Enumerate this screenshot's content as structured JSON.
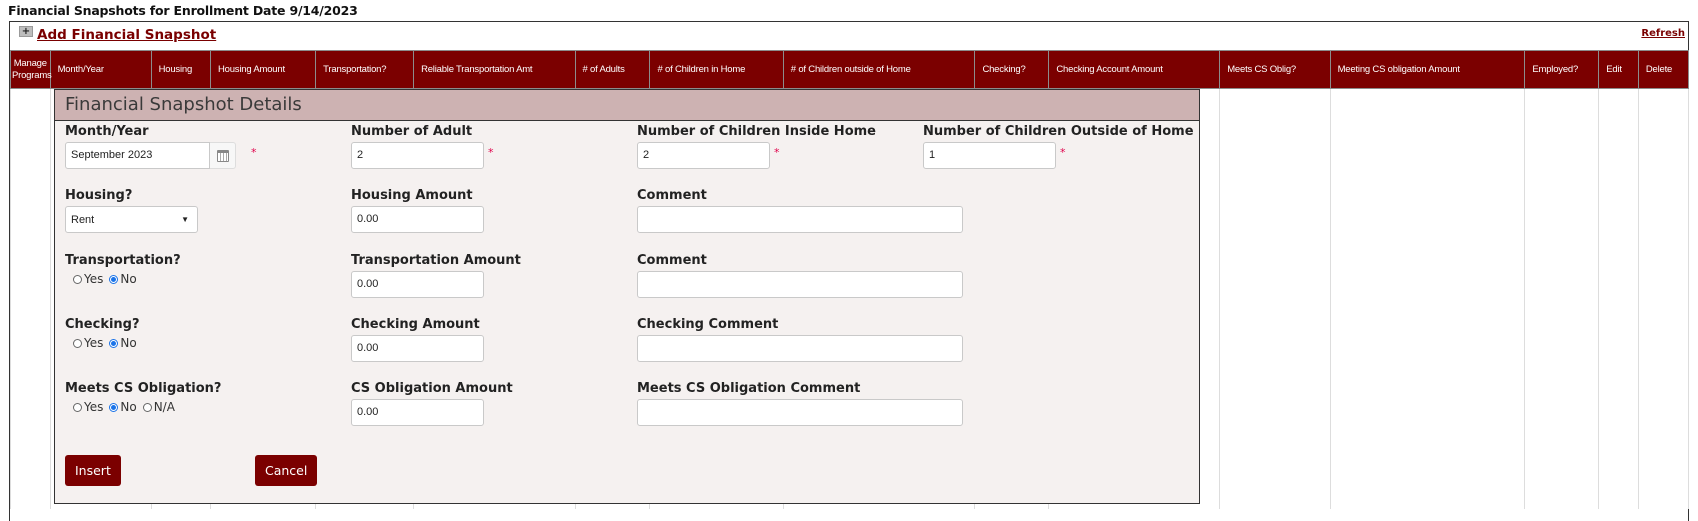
{
  "page": {
    "title": "Financial Snapshots for Enrollment Date 9/14/2023",
    "add_link": "Add Financial Snapshot",
    "refresh": "Refresh"
  },
  "grid": {
    "columns": [
      "Manage Programs",
      "Month/Year",
      "Housing",
      "Housing Amount",
      "Transportation?",
      "Reliable Transportation Amt",
      "# of Adults",
      "# of Children in Home",
      "# of Children outside of Home",
      "Checking?",
      "Checking Account Amount",
      "Meets CS Oblig?",
      "Meeting CS obligation Amount",
      "Employed?",
      "Edit",
      "Delete"
    ]
  },
  "panel": {
    "title": "Financial Snapshot Details",
    "month_year": {
      "label": "Month/Year",
      "value": "September 2023"
    },
    "num_adult": {
      "label": "Number of Adult",
      "value": "2"
    },
    "children_inside": {
      "label": "Number of Children Inside Home",
      "value": "2"
    },
    "children_outside": {
      "label": "Number of Children Outside of Home",
      "value": "1"
    },
    "housing": {
      "label": "Housing?",
      "value": "Rent"
    },
    "housing_amount": {
      "label": "Housing Amount",
      "value": "0.00"
    },
    "housing_comment": {
      "label": "Comment",
      "value": ""
    },
    "transportation": {
      "label": "Transportation?",
      "options": [
        "Yes",
        "No"
      ],
      "selected": "No"
    },
    "transportation_amount": {
      "label": "Transportation Amount",
      "value": "0.00"
    },
    "transportation_comment": {
      "label": "Comment",
      "value": ""
    },
    "checking": {
      "label": "Checking?",
      "options": [
        "Yes",
        "No"
      ],
      "selected": "No"
    },
    "checking_amount": {
      "label": "Checking Amount",
      "value": "0.00"
    },
    "checking_comment": {
      "label": "Checking Comment",
      "value": ""
    },
    "cs": {
      "label": "Meets CS Obligation?",
      "options": [
        "Yes",
        "No",
        "N/A"
      ],
      "selected": "No"
    },
    "cs_amount": {
      "label": "CS Obligation Amount",
      "value": "0.00"
    },
    "cs_comment": {
      "label": "Meets CS Obligation Comment",
      "value": ""
    },
    "required_mark": "*",
    "insert": "Insert",
    "cancel": "Cancel"
  },
  "colors": {
    "brand": "#7b0000",
    "panel_header": "#cdb2b2",
    "panel_bg": "#f5f1f0"
  }
}
